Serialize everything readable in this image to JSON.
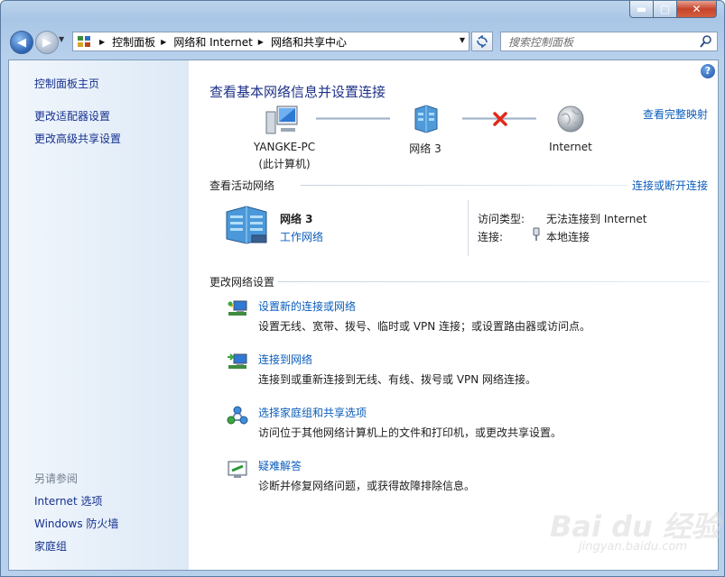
{
  "window": {
    "controls": {
      "minimize": "▬",
      "maximize": "▢",
      "close": "✕"
    }
  },
  "nav": {
    "back": "◀",
    "forward": "▶",
    "breadcrumbs": [
      "控制面板",
      "网络和 Internet",
      "网络和共享中心"
    ],
    "search_placeholder": "搜索控制面板"
  },
  "sidebar": {
    "items": [
      "控制面板主页",
      "更改适配器设置",
      "更改高级共享设置"
    ],
    "see_also_label": "另请参阅",
    "see_also_items": [
      "Internet 选项",
      "Windows 防火墙",
      "家庭组"
    ]
  },
  "main": {
    "help": "?",
    "title": "查看基本网络信息并设置连接",
    "full_map_link": "查看完整映射",
    "map": {
      "computer_name": "YANGKE-PC",
      "computer_sub": "(此计算机)",
      "network_name": "网络  3",
      "internet_name": "Internet"
    },
    "active": {
      "header": "查看活动网络",
      "connect_link": "连接或断开连接",
      "network_name": "网络  3",
      "network_type": "工作网络",
      "access_type_label": "访问类型:",
      "access_type_value": "无法连接到 Internet",
      "connection_label": "连接:",
      "connection_value": "本地连接"
    },
    "change": {
      "header": "更改网络设置",
      "tasks": [
        {
          "title": "设置新的连接或网络",
          "desc": "设置无线、宽带、拨号、临时或 VPN 连接；或设置路由器或访问点。",
          "icon": "new-connection-icon"
        },
        {
          "title": "连接到网络",
          "desc": "连接到或重新连接到无线、有线、拨号或 VPN 网络连接。",
          "icon": "connect-network-icon"
        },
        {
          "title": "选择家庭组和共享选项",
          "desc": "访问位于其他网络计算机上的文件和打印机，或更改共享设置。",
          "icon": "homegroup-icon"
        },
        {
          "title": "疑难解答",
          "desc": "诊断并修复网络问题，或获得故障排除信息。",
          "icon": "troubleshoot-icon"
        }
      ]
    }
  },
  "watermark": {
    "text": "Bai du 经验",
    "sub": "jingyan.baidu.com"
  },
  "colors": {
    "link": "#0b5dbb",
    "title": "#1e3287",
    "sidebar_link": "#15318f",
    "error_x": "#e02a1b"
  }
}
